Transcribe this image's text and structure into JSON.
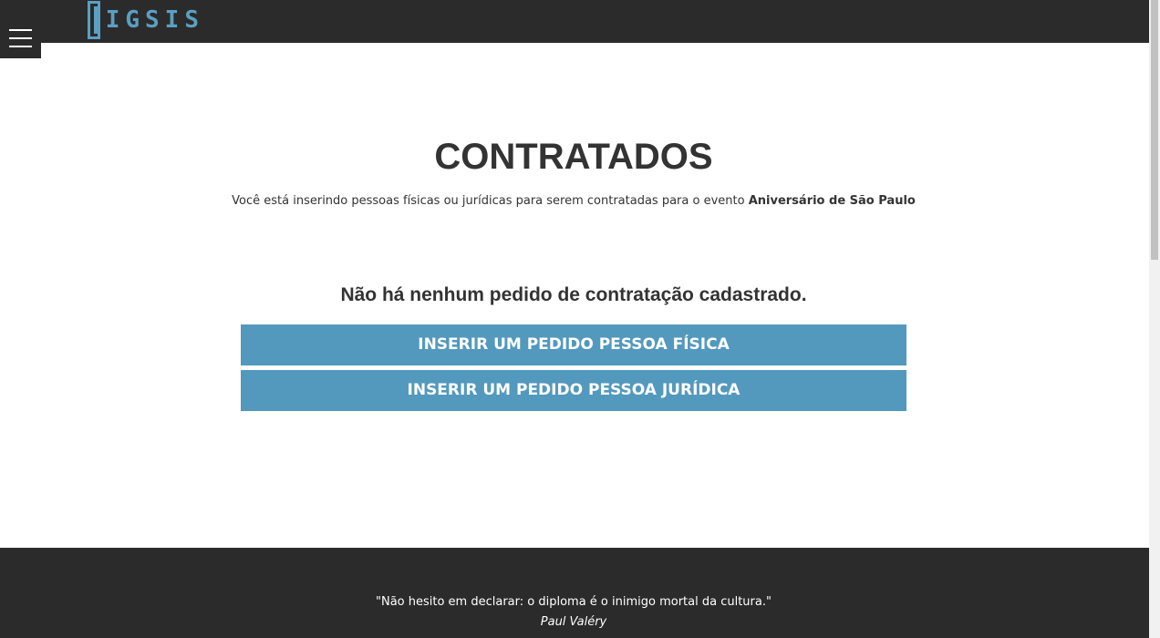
{
  "header": {
    "logo_text": "IGSIS",
    "menu_icon": "hamburger-icon"
  },
  "main": {
    "title": "CONTRATADOS",
    "subtitle_prefix": "Você está inserindo pessoas físicas ou jurídicas para serem contratadas para o evento ",
    "event_name": "Aniversário de São Paulo",
    "empty_message": "Não há nenhum pedido de contratação cadastrado.",
    "btn_pessoa_fisica": "INSERIR UM PEDIDO PESSOA FÍSICA",
    "btn_pessoa_juridica": "INSERIR UM PEDIDO PESSOA JURÍDICA"
  },
  "footer": {
    "quote": "\"Não hesito em declarar: o diploma é o inimigo mortal da cultura.\"",
    "author": "Paul Valéry"
  },
  "colors": {
    "header_bg": "#2b2b2b",
    "accent": "#5399bd",
    "logo": "#5b9fc2",
    "text": "#333333"
  }
}
